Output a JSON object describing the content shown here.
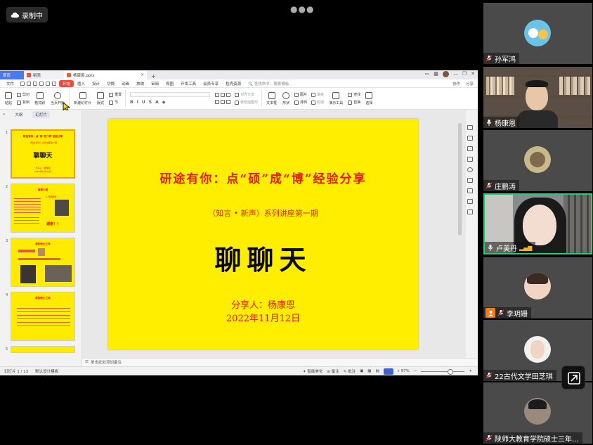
{
  "meeting": {
    "recording_label": "录制中"
  },
  "wps": {
    "tabs": [
      {
        "label": "首页"
      },
      {
        "label": "稻壳"
      },
      {
        "label": "杨康恩.pptx"
      }
    ],
    "menu": {
      "file": "文件",
      "items": [
        "开始",
        "插入",
        "设计",
        "切换",
        "动画",
        "放映",
        "审阅",
        "视图",
        "开发工具",
        "会员专享",
        "稻壳资源"
      ],
      "search": "查找命令、搜索模板",
      "collab": "协作",
      "share": "分享"
    },
    "toolbar": {
      "paste": "粘贴",
      "cut": "剪切",
      "copy": "复制",
      "format_painter": "格式刷",
      "play_from_current": "当页开始",
      "new_slide": "新建幻灯片",
      "layout": "版式",
      "section": "节",
      "reset": "重置",
      "align_text": "对齐文本",
      "smart_art": "转智能图形",
      "textbox": "文本框",
      "shape": "形状",
      "arrange": "排列",
      "picture": "图片",
      "fill": "填充",
      "outline": "轮廓",
      "presenter_tools": "演示工具",
      "find": "查找",
      "replace": "替换",
      "select": "选择"
    },
    "left_panel": {
      "tab_outline": "大纲",
      "tab_slides": "幻灯片",
      "thumbs": [
        {
          "num": "1",
          "title": "研途有你：点“硕”成“博”经验分享",
          "sub": "《知言·新声》系列讲座第一期",
          "big": "聊聊天",
          "speaker": "分享人：杨康恩",
          "date": "2022年11月12日"
        },
        {
          "num": "2",
          "title": "自我介绍",
          "tag": "[ 开题报告 ]",
          "thanks": "谢谢！！"
        },
        {
          "num": "3",
          "title": "我的硕士三年"
        },
        {
          "num": "4",
          "title": "我的硕士三年"
        },
        {
          "num": "5"
        }
      ]
    },
    "slide": {
      "title": "研途有你：点“硕”成“博”经验分享",
      "subtitle": "〈知言 • 新声〉系列讲座第一期",
      "big_text": "聊聊天",
      "speaker": "分享人：杨康恩",
      "date": "2022年11月12日"
    },
    "notes_placeholder": "单击此处添加备注",
    "status": {
      "slide_counter": "幻灯片 1 / 13",
      "theme": "默认设计模板",
      "smart_beautify": "智能美化",
      "notes": "备注",
      "comments": "批注",
      "zoom": "97%"
    }
  },
  "participants": [
    {
      "name": "孙军鸿"
    },
    {
      "name": "杨康恩"
    },
    {
      "name": "庄鹏涛"
    },
    {
      "name": "卢美丹"
    },
    {
      "name": "李玥姗"
    },
    {
      "name": "22古代文学田芝琪"
    },
    {
      "name": "陕师大教育学院硕士三年..."
    }
  ],
  "colors": {
    "slide_bg": "#ffee00",
    "slide_red": "#e01e14",
    "active_speaker": "#1bd074",
    "wps_accent": "#ef4b3c"
  }
}
